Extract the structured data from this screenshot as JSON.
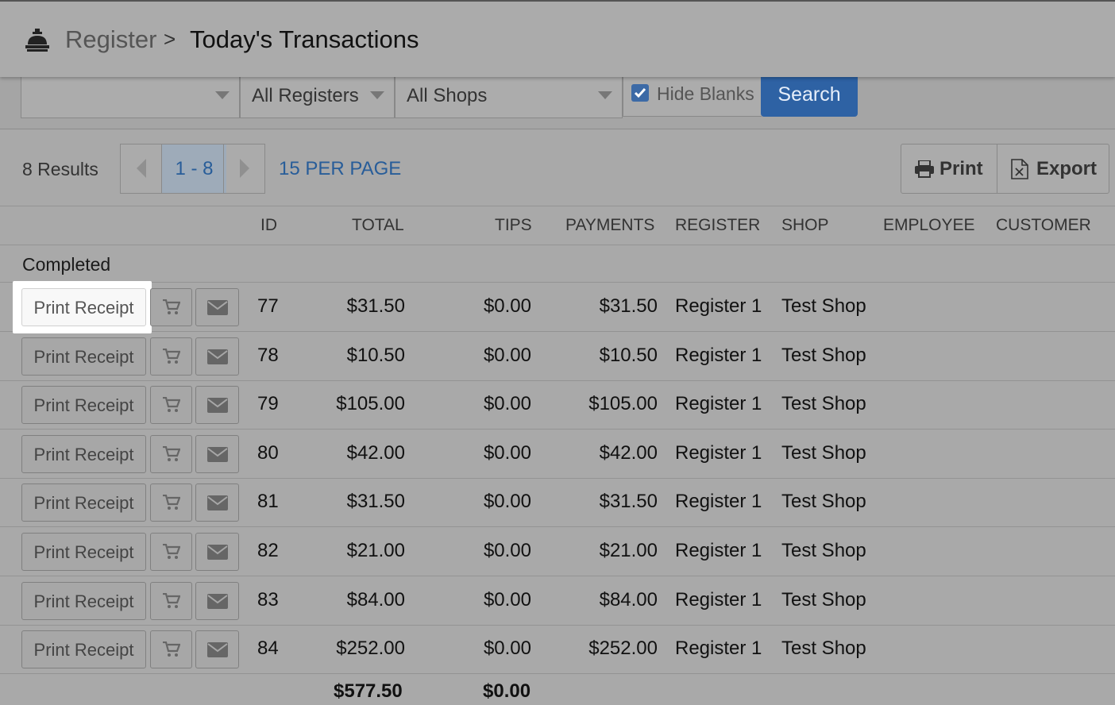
{
  "header": {
    "logo_icon": "register-bell-icon",
    "breadcrumb_root": "Register",
    "separator": ">",
    "title": "Today's Transactions"
  },
  "filters": {
    "first_select_value": "",
    "registers_value": "All Registers",
    "shops_value": "All Shops",
    "hide_blanks_label": "Hide Blanks",
    "hide_blanks_checked": true,
    "search_label": "Search"
  },
  "toolbar": {
    "results": "8 Results",
    "page_range": "1 - 8",
    "per_page": "15 PER PAGE",
    "print_label": "Print",
    "export_label": "Export"
  },
  "columns": {
    "id": "ID",
    "total": "TOTAL",
    "tips": "TIPS",
    "payments": "PAYMENTS",
    "register": "REGISTER",
    "shop": "SHOP",
    "employee": "EMPLOYEE",
    "customer": "CUSTOMER"
  },
  "group_title": "Completed",
  "print_receipt_label": "Print Receipt",
  "rows": [
    {
      "id": "77",
      "total": "$31.50",
      "tips": "$0.00",
      "payments": "$31.50",
      "register": "Register 1",
      "shop": "Test Shop"
    },
    {
      "id": "78",
      "total": "$10.50",
      "tips": "$0.00",
      "payments": "$10.50",
      "register": "Register 1",
      "shop": "Test Shop"
    },
    {
      "id": "79",
      "total": "$105.00",
      "tips": "$0.00",
      "payments": "$105.00",
      "register": "Register 1",
      "shop": "Test Shop"
    },
    {
      "id": "80",
      "total": "$42.00",
      "tips": "$0.00",
      "payments": "$42.00",
      "register": "Register 1",
      "shop": "Test Shop"
    },
    {
      "id": "81",
      "total": "$31.50",
      "tips": "$0.00",
      "payments": "$31.50",
      "register": "Register 1",
      "shop": "Test Shop"
    },
    {
      "id": "82",
      "total": "$21.00",
      "tips": "$0.00",
      "payments": "$21.00",
      "register": "Register 1",
      "shop": "Test Shop"
    },
    {
      "id": "83",
      "total": "$84.00",
      "tips": "$0.00",
      "payments": "$84.00",
      "register": "Register 1",
      "shop": "Test Shop"
    },
    {
      "id": "84",
      "total": "$252.00",
      "tips": "$0.00",
      "payments": "$252.00",
      "register": "Register 1",
      "shop": "Test Shop"
    }
  ],
  "totals": {
    "total": "$577.50",
    "tips": "$0.00"
  },
  "colors": {
    "accent": "#2e62a4",
    "link": "#285d99",
    "overlay_background": "#a9a9a9"
  }
}
